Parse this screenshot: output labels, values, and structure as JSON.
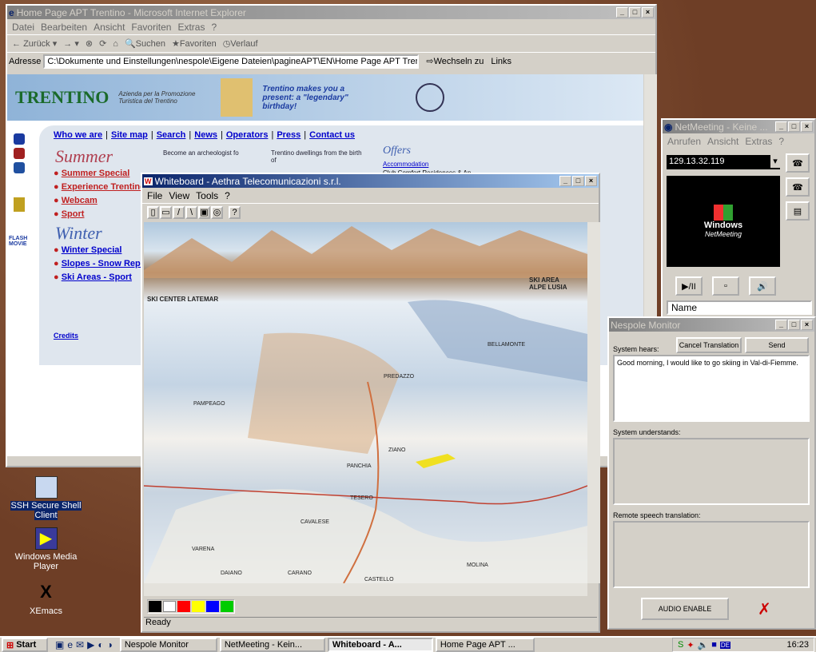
{
  "ie": {
    "title": "Home Page APT Trentino - Microsoft Internet Explorer",
    "menu": [
      "Datei",
      "Bearbeiten",
      "Ansicht",
      "Favoriten",
      "Extras",
      "?"
    ],
    "toolbar": {
      "back": "Zurück",
      "search": "Suchen",
      "favorites": "Favoriten",
      "history": "Verlauf"
    },
    "address_label": "Adresse",
    "address": "C:\\Dokumente und Einstellungen\\nespole\\Eigene Dateien\\pagineAPT\\EN\\Home Page APT Trentino.htm",
    "go": "Wechseln zu",
    "links": "Links"
  },
  "page": {
    "logo": "TRENTINO",
    "tagline1": "Azienda per la Promozione",
    "tagline2": "Turistica del Trentino",
    "promo": "Trentino makes you a present: a \"legendary\" birthday!",
    "nav": [
      "Who we are",
      "Site map",
      "Search",
      "News",
      "Operators",
      "Press",
      "Contact us"
    ],
    "summer_heading": "Summer",
    "summer_links": [
      "Summer Special",
      "Experience Trentino",
      "Webcam",
      "Sport"
    ],
    "winter_heading": "Winter",
    "winter_links": [
      "Winter Special",
      "Slopes - Snow Repo",
      "Ski Areas - Sport"
    ],
    "credits": "Credits",
    "flash": "FLASH MOVIE",
    "news1": "Become an archeologist fo",
    "news2": "Trentino dwellings from the birth of",
    "offers": "Offers",
    "offer1": "Accommodation",
    "offer2": "Club Comfort Residences & Ap"
  },
  "whiteboard": {
    "title": "Whiteboard - Aethra Telecomunicazioni s.r.l.",
    "menu": [
      "File",
      "View",
      "Tools",
      "?"
    ],
    "status": "Ready",
    "palette": [
      "#000000",
      "#ffffff",
      "#ff0000",
      "#ffff00",
      "#0000ff",
      "#00cc00"
    ],
    "map_labels": [
      "SKI CENTER LATEMAR",
      "SKI AREA ALPE LUSIA",
      "BELLAMONTE",
      "PREDAZZO",
      "ZIANO",
      "PANCHIA",
      "TESERO",
      "CAVALESE",
      "VARENA",
      "DAIANO",
      "CARANO",
      "CASTELLO",
      "MOLINA",
      "PAMPEAGO"
    ]
  },
  "netmeeting": {
    "title": "NetMeeting - Keine ...",
    "menu": [
      "Anrufen",
      "Ansicht",
      "Extras",
      "?"
    ],
    "address": "129.13.32.119",
    "logo1": "Windows",
    "logo2": "NetMeeting",
    "name_col": "Name"
  },
  "monitor": {
    "title": "Nespole Monitor",
    "hears_label": "System hears:",
    "cancel": "Cancel Translation",
    "send": "Send",
    "hears_text": "Good morning, I would like to go skiing in Val-di-Fiemme.",
    "understands_label": "System understands:",
    "remote_label": "Remote speech translation:",
    "audio": "AUDIO ENABLE"
  },
  "desktop": {
    "icons": [
      "SSH Secure Shell Client",
      "Windows Media Player",
      "XEmacs"
    ]
  },
  "taskbar": {
    "start": "Start",
    "tasks": [
      "Nespole Monitor",
      "NetMeeting - Kein...",
      "Whiteboard - A...",
      "Home Page APT ..."
    ],
    "clock": "16:23"
  }
}
